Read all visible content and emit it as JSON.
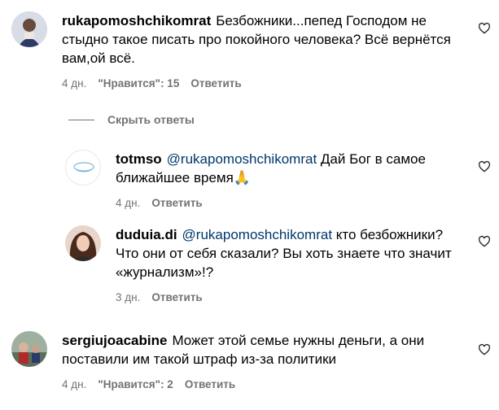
{
  "comments": [
    {
      "username": "rukapomoshchikomrat",
      "text": "Безбожники...пепед Господом не стыдно такое писать про покойного человека? Всё вернётся вам,ой всё.",
      "age": "4 дн.",
      "likes": "\"Нравится\": 15",
      "reply": "Ответить"
    },
    {
      "username": "sergiujoacabine",
      "text": "Может этой семье нужны деньги, а они поставили им такой штраф из-за политики",
      "age": "4 дн.",
      "likes": "\"Нравится\": 2",
      "reply": "Ответить"
    }
  ],
  "hide_replies": "Скрыть ответы",
  "replies": [
    {
      "username": "totmso",
      "mention": "@rukapomoshchikomrat",
      "text": "Дай Бог в самое ближайшее время🙏",
      "age": "4 дн.",
      "reply": "Ответить"
    },
    {
      "username": "duduia.di",
      "mention": "@rukapomoshchikomrat",
      "text": "кто безбожники? Что они от себя сказали? Вы хоть знаете что значит «журнализм»!?",
      "age": "3 дн.",
      "reply": "Ответить"
    }
  ],
  "icons": {
    "like": "heart-outline-icon"
  },
  "colors": {
    "meta": "#737373",
    "mention": "#00376b"
  }
}
